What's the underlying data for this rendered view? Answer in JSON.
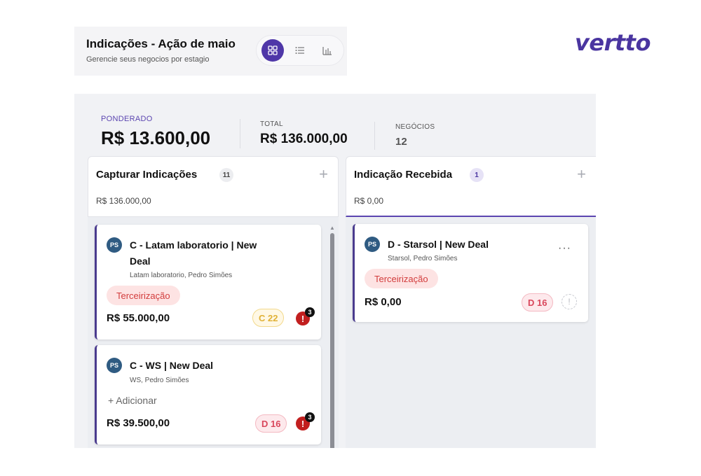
{
  "header": {
    "title": "Indicações - Ação de maio",
    "subtitle": "Gerencie seus negocios por estagio",
    "views": [
      {
        "icon": "grid-icon",
        "active": true
      },
      {
        "icon": "list-icon",
        "active": false
      },
      {
        "icon": "bar-chart-icon",
        "active": false
      }
    ]
  },
  "logo": "vertto",
  "stats": {
    "ponderado_label": "PONDERADO",
    "ponderado_value": "R$ 13.600,00",
    "total_label": "TOTAL",
    "total_value": "R$ 136.000,00",
    "negocios_label": "NEGÓCIOS",
    "negocios_value": "12"
  },
  "columns": [
    {
      "title": "Capturar Indicações",
      "count": "11",
      "amount": "R$ 136.000,00",
      "cards": [
        {
          "avatar": "PS",
          "title_line1": "C - Latam laboratorio | New",
          "title_line2": "Deal",
          "subtitle": "Latam laboratorio, Pedro Simões",
          "tag": "Terceirização",
          "value": "R$ 55.000,00",
          "pill": "C 22",
          "alert": "!",
          "alert_count": "3"
        },
        {
          "avatar": "PS",
          "title_line1": "C - WS | New Deal",
          "subtitle": "WS, Pedro Simões",
          "add_label": "+ Adicionar",
          "value": "R$ 39.500,00",
          "pill": "D 16",
          "alert": "!",
          "alert_count": "3"
        }
      ]
    },
    {
      "title": "Indicação Recebida",
      "count": "1",
      "amount": "R$ 0,00",
      "cards": [
        {
          "avatar": "PS",
          "title_line1": "D - Starsol | New Deal",
          "subtitle": "Starsol, Pedro Simões",
          "tag": "Terceirização",
          "value": "R$ 0,00",
          "pill": "D 16",
          "more": "···",
          "alert": "!"
        }
      ]
    }
  ],
  "colors": {
    "accent": "#4f37a8",
    "logo": "#4a35a0",
    "tag_bg": "#fde3e3",
    "tag_text": "#d23c3c",
    "alert": "#c21f1f"
  }
}
